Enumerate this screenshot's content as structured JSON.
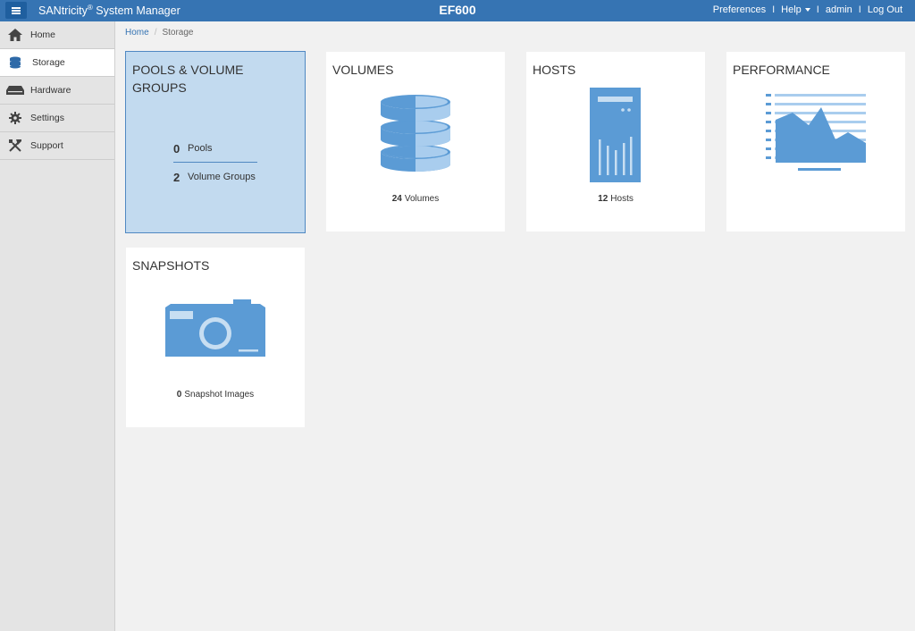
{
  "header": {
    "app_title": "SANtricity",
    "app_title_mark": "®",
    "app_title_suffix": " System Manager",
    "system_name": "EF600",
    "links": {
      "preferences": "Preferences",
      "help": "Help",
      "user": "admin",
      "logout": "Log Out"
    },
    "separator": "I"
  },
  "sidebar": {
    "items": [
      {
        "label": "Home",
        "icon": "home-icon"
      },
      {
        "label": "Storage",
        "icon": "storage-icon",
        "active": true
      },
      {
        "label": "Hardware",
        "icon": "hardware-icon"
      },
      {
        "label": "Settings",
        "icon": "gear-icon"
      },
      {
        "label": "Support",
        "icon": "tools-icon"
      }
    ]
  },
  "breadcrumb": {
    "home": "Home",
    "separator": "/",
    "current": "Storage"
  },
  "tiles": {
    "pools": {
      "title": "POOLS & VOLUME GROUPS",
      "pools_count": "0",
      "pools_label": "Pools",
      "groups_count": "2",
      "groups_label": "Volume Groups"
    },
    "volumes": {
      "title": "VOLUMES",
      "count": "24",
      "label": "Volumes"
    },
    "hosts": {
      "title": "HOSTS",
      "count": "12",
      "label": "Hosts"
    },
    "performance": {
      "title": "PERFORMANCE"
    },
    "snapshots": {
      "title": "SNAPSHOTS",
      "count": "0",
      "label": "Snapshot Images"
    }
  },
  "colors": {
    "header": "#3674b3",
    "icon_dark": "#5b9bd5",
    "icon_light": "#a9cdee",
    "selected_tile": "#c2daef"
  }
}
